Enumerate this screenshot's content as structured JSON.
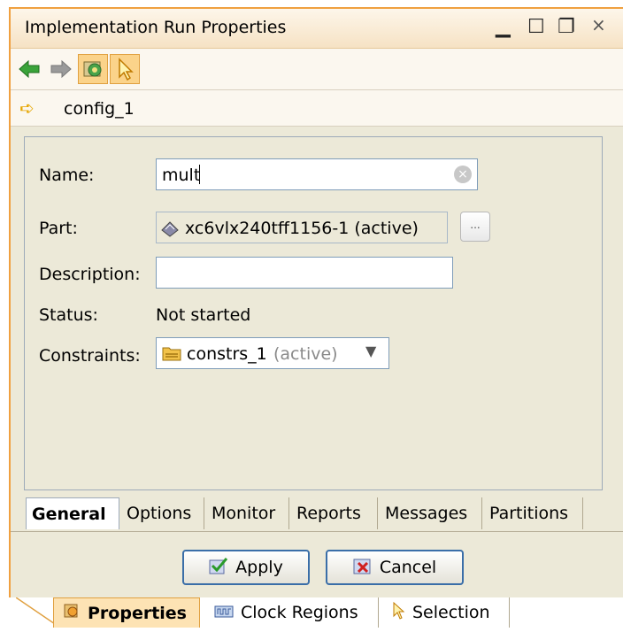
{
  "window": {
    "title": "Implementation Run Properties",
    "controls": {
      "minimize": "▁",
      "maximize": "☐",
      "restore": "❐",
      "close": "×"
    }
  },
  "toolbar": {
    "icons": [
      "back-arrow-icon",
      "forward-arrow-icon",
      "auto-update-icon",
      "selection-pointer-icon"
    ]
  },
  "breadcrumb": {
    "text": "config_1"
  },
  "form": {
    "name_label": "Name:",
    "name_value": "mult",
    "part_label": "Part:",
    "part_value": "xc6vlx240tff1156-1 (active)",
    "part_browse": "...",
    "description_label": "Description:",
    "description_value": "",
    "status_label": "Status:",
    "status_value": "Not started",
    "constraints_label": "Constraints:",
    "constraints_value": "constrs_1",
    "constraints_suffix": "(active)"
  },
  "tabs": [
    "General",
    "Options",
    "Monitor",
    "Reports",
    "Messages",
    "Partitions"
  ],
  "buttons": {
    "apply": "Apply",
    "cancel": "Cancel"
  },
  "bottom_tabs": [
    "Properties",
    "Clock Regions",
    "Selection"
  ],
  "colors": {
    "accent": "#f0a040",
    "panel_border": "#9daab9",
    "button_border": "#3a6ea8"
  }
}
